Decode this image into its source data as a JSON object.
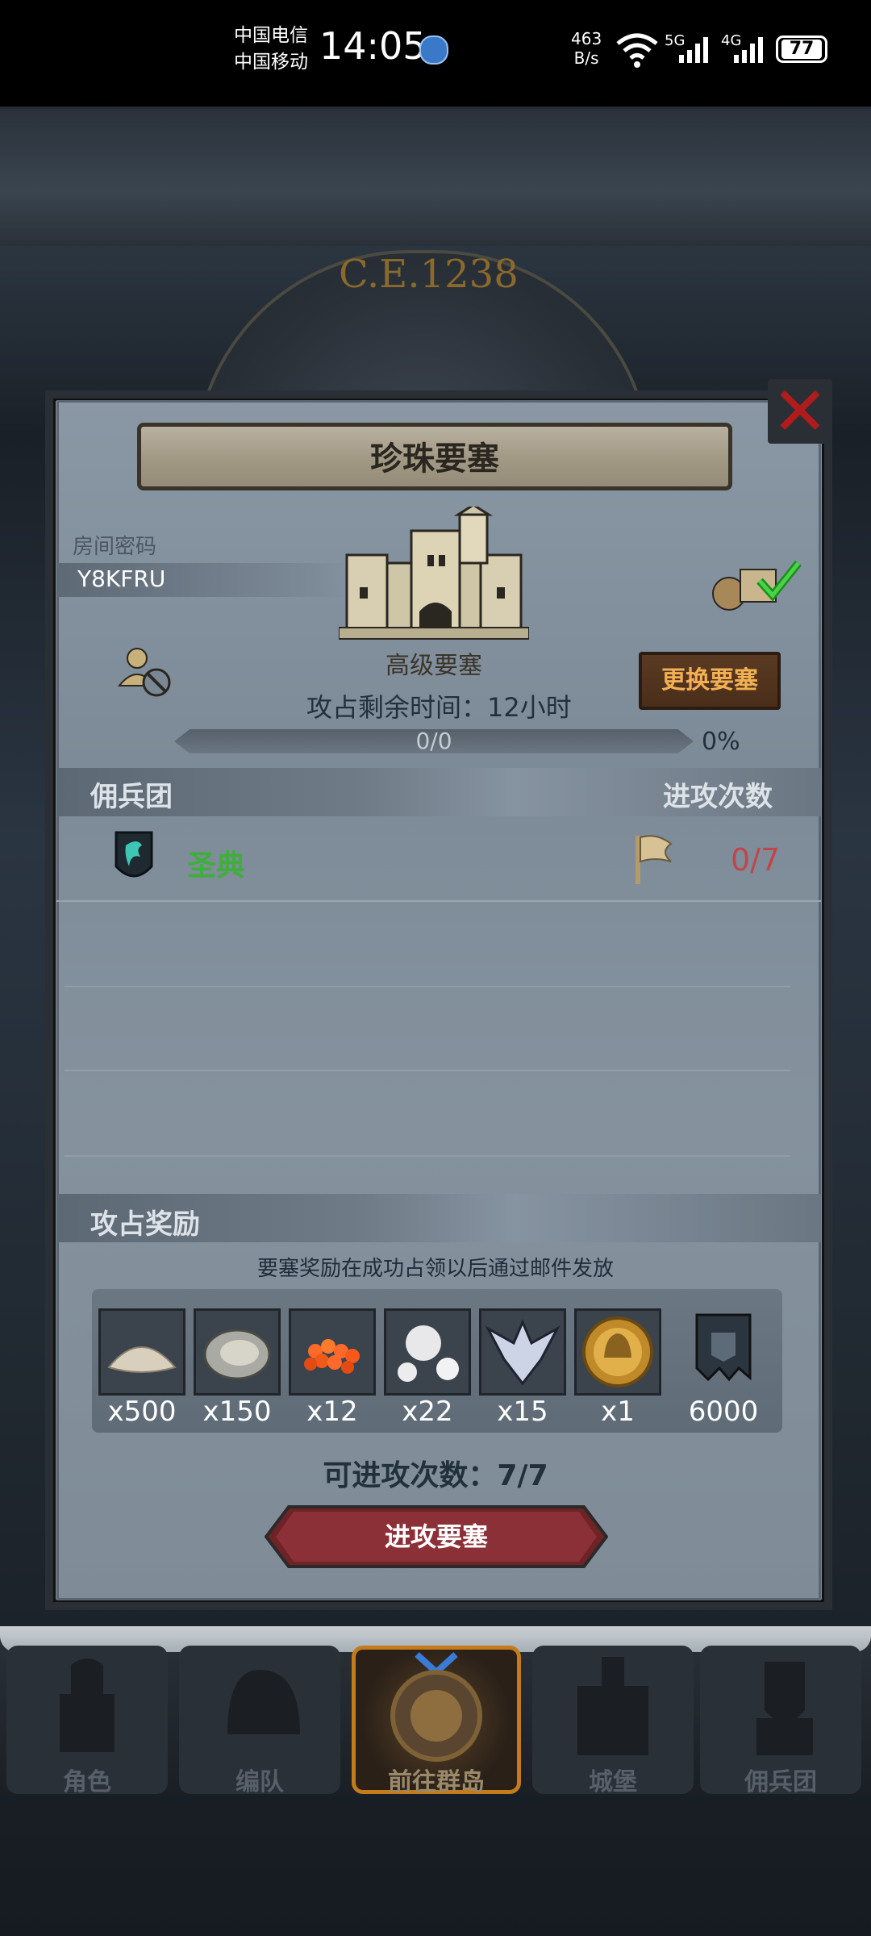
{
  "status_bar": {
    "carrier1": "中国电信",
    "carrier2": "中国移动",
    "time": "14:05",
    "net_speed_value": "463",
    "net_speed_unit": "B/s",
    "signal1_label": "5G",
    "signal2_label": "4G",
    "battery": "77"
  },
  "background": {
    "era": "C.E.1238"
  },
  "panel": {
    "title": "珍珠要塞",
    "room_password_label": "房间密码",
    "room_password": "Y8KFRU",
    "fortress_level": "高级要塞",
    "change_button": "更换要塞",
    "remaining_time": "攻占剩余时间：12小时",
    "progress_text": "0/0",
    "progress_percent": "0%",
    "progress_value": 0,
    "guild_section_label": "佣兵团",
    "attack_count_header": "进攻次数",
    "guild": {
      "name": "圣典",
      "attacks": "0/7"
    },
    "reward_section_label": "攻占奖励",
    "reward_note": "要塞奖励在成功占领以后通过邮件发放",
    "rewards": [
      {
        "icon": "sand-pile-icon",
        "qty": "x500"
      },
      {
        "icon": "oyster-icon",
        "qty": "x150"
      },
      {
        "icon": "fish-roe-icon",
        "qty": "x12"
      },
      {
        "icon": "pearls-icon",
        "qty": "x22"
      },
      {
        "icon": "winged-emblem-icon",
        "qty": "x15"
      },
      {
        "icon": "knight-coin-icon",
        "qty": "x1"
      },
      {
        "icon": "banner-icon",
        "qty": "6000"
      }
    ],
    "attack_times": "可进攻次数：7/7",
    "attack_button": "进攻要塞"
  },
  "bottom_nav": {
    "tabs": [
      {
        "label": "角色",
        "icon": "knight-icon"
      },
      {
        "label": "编队",
        "icon": "helmet-icon"
      },
      {
        "label": "前往群岛",
        "icon": "compass-icon"
      },
      {
        "label": "城堡",
        "icon": "castle-icon"
      },
      {
        "label": "佣兵团",
        "icon": "mercenary-icon"
      }
    ]
  },
  "colors": {
    "guild_name": "#3fae3b",
    "attack_count": "#c0464a",
    "change_button_text": "#f3b053",
    "close_x": "#b01c1c"
  }
}
